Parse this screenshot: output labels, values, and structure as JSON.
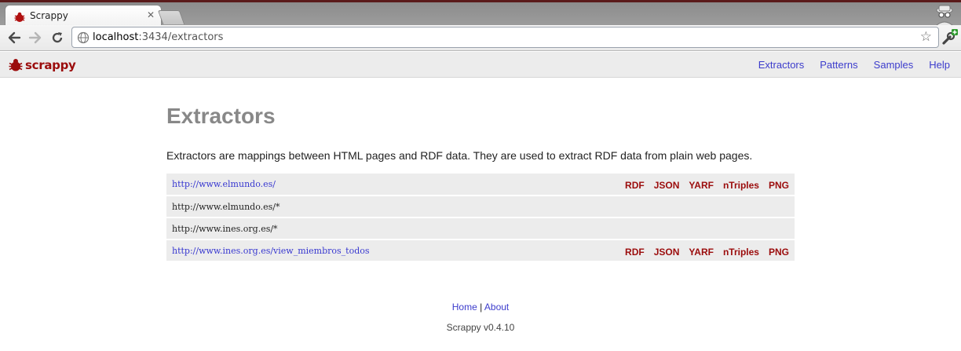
{
  "browser": {
    "tab_title": "Scrappy",
    "url_host": "localhost",
    "url_rest": ":3434/extractors"
  },
  "colors": {
    "brand": "#9b0c0c",
    "link": "#3c3ccc",
    "row_bg": "#ececec",
    "title_gray": "#888888"
  },
  "header": {
    "logo_text": "scrappy",
    "nav": [
      "Extractors",
      "Patterns",
      "Samples",
      "Help"
    ]
  },
  "main": {
    "title": "Extractors",
    "description": "Extractors are mappings between HTML pages and RDF data. They are used to extract RDF data from plain web pages.",
    "extractors": [
      {
        "url": "http://www.elmundo.es/",
        "link": true,
        "formats": [
          "RDF",
          "JSON",
          "YARF",
          "nTriples",
          "PNG"
        ]
      },
      {
        "url": "http://www.elmundo.es/*",
        "link": false,
        "formats": []
      },
      {
        "url": "http://www.ines.org.es/*",
        "link": false,
        "formats": []
      },
      {
        "url": "http://www.ines.org.es/view_miembros_todos",
        "link": true,
        "formats": [
          "RDF",
          "JSON",
          "YARF",
          "nTriples",
          "PNG"
        ]
      }
    ]
  },
  "footer": {
    "home": "Home",
    "separator": "|",
    "about": "About",
    "version": "Scrappy v0.4.10"
  }
}
